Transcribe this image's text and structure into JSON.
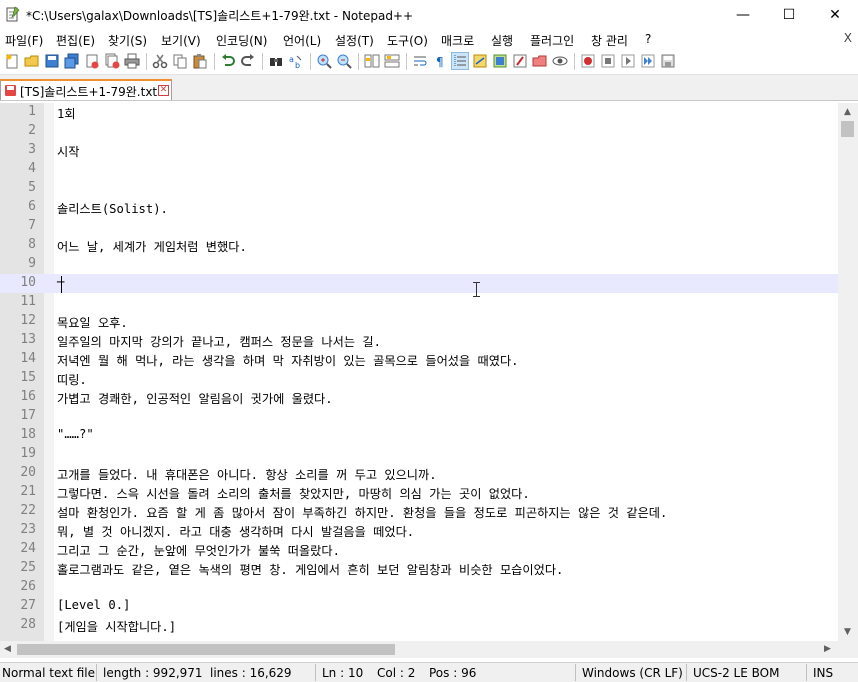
{
  "window": {
    "title": "*C:\\Users\\galax\\Downloads\\[TS]솔리스트+1-79완.txt - Notepad++",
    "minimize": "—",
    "maximize": "☐",
    "close": "✕"
  },
  "menu": {
    "items": [
      "파일(F)",
      "편집(E)",
      "찾기(S)",
      "보기(V)",
      "인코딩(N)",
      "언어(L)",
      "설정(T)",
      "도구(O)",
      "매크로",
      "실행",
      "플러그인",
      "창 관리",
      "?"
    ],
    "close": "X"
  },
  "tabs": [
    {
      "label": "[TS]솔리스트+1-79완.txt"
    }
  ],
  "editor": {
    "lines": [
      {
        "n": "1",
        "text": "1회"
      },
      {
        "n": "2",
        "text": ""
      },
      {
        "n": "3",
        "text": "시작"
      },
      {
        "n": "4",
        "text": ""
      },
      {
        "n": "5",
        "text": ""
      },
      {
        "n": "6",
        "text": "솔리스트(Solist)."
      },
      {
        "n": "7",
        "text": ""
      },
      {
        "n": "8",
        "text": "어느 날, 세계가 게임처럼 변했다."
      },
      {
        "n": "9",
        "text": ""
      },
      {
        "n": "10",
        "text": "─"
      },
      {
        "n": "11",
        "text": ""
      },
      {
        "n": "12",
        "text": "목요일 오후."
      },
      {
        "n": "13",
        "text": "일주일의 마지막 강의가 끝나고, 캠퍼스 정문을 나서는 길."
      },
      {
        "n": "14",
        "text": "저녁엔 뭘 해 먹나, 라는 생각을 하며 막 자취방이 있는 골목으로 들어섰을 때였다."
      },
      {
        "n": "15",
        "text": "띠링."
      },
      {
        "n": "16",
        "text": "가볍고 경쾌한, 인공적인 알림음이 귓가에 울렸다."
      },
      {
        "n": "17",
        "text": ""
      },
      {
        "n": "18",
        "text": "\"……?\""
      },
      {
        "n": "19",
        "text": ""
      },
      {
        "n": "20",
        "text": "고개를 들었다. 내 휴대폰은 아니다. 항상 소리를 꺼 두고 있으니까."
      },
      {
        "n": "21",
        "text": "그렇다면. 스윽 시선을 돌려 소리의 출처를 찾았지만, 마땅히 의심 가는 곳이 없었다."
      },
      {
        "n": "22",
        "text": "설마 환청인가. 요즘 할 게 좀 많아서 잠이 부족하긴 하지만. 환청을 들을 정도로 피곤하지는 않은 것 같은데."
      },
      {
        "n": "23",
        "text": "뭐, 별 것 아니겠지. 라고 대충 생각하며 다시 발걸음을 떼었다."
      },
      {
        "n": "24",
        "text": "그리고 그 순간, 눈앞에 무엇인가가 불쑥 떠올랐다."
      },
      {
        "n": "25",
        "text": "홀로그램과도 같은, 옅은 녹색의 평면 창. 게임에서 흔히 보던 알림창과 비슷한 모습이었다."
      },
      {
        "n": "26",
        "text": ""
      },
      {
        "n": "27",
        "text": "[Level 0.]"
      },
      {
        "n": "28",
        "text": "[게임을 시작합니다.]"
      }
    ],
    "current_line": 10
  },
  "status": {
    "type": "Normal text file",
    "length": "length : 992,971",
    "lines": "lines : 16,629",
    "ln": "Ln : 10",
    "col": "Col : 2",
    "pos": "Pos : 96",
    "eol": "Windows (CR LF)",
    "encoding": "UCS-2 LE BOM",
    "mode": "INS"
  }
}
